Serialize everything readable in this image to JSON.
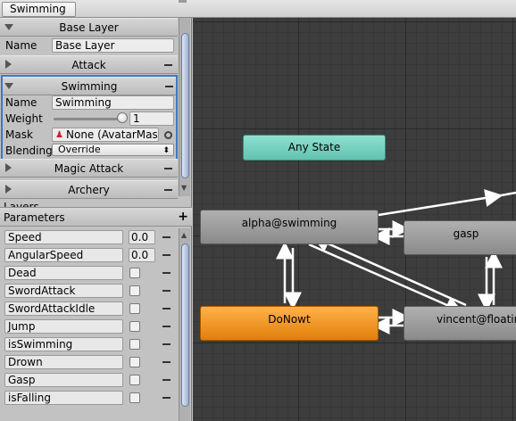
{
  "breadcrumb": {
    "label": "Swimming"
  },
  "layers": {
    "base": {
      "title": "Base Layer",
      "name_label": "Name",
      "name_value": "Base Layer"
    },
    "attack": {
      "title": "Attack"
    },
    "swimming": {
      "title": "Swimming",
      "name_label": "Name",
      "name_value": "Swimming",
      "weight_label": "Weight",
      "weight_value": "1",
      "weight_level": 1.0,
      "mask_label": "Mask",
      "mask_value": "None (AvatarMask)",
      "blending_label": "Blending",
      "blending_value": "Override"
    },
    "magic": {
      "title": "Magic Attack"
    },
    "archery": {
      "title": "Archery"
    },
    "footer_label": "Layers"
  },
  "parameters": {
    "title": "Parameters",
    "items": [
      {
        "name": "Speed",
        "type": "float",
        "value": "0.0"
      },
      {
        "name": "AngularSpeed",
        "type": "float",
        "value": "0.0"
      },
      {
        "name": "Dead",
        "type": "bool"
      },
      {
        "name": "SwordAttack",
        "type": "bool"
      },
      {
        "name": "SwordAttackIdle",
        "type": "bool"
      },
      {
        "name": "Jump",
        "type": "bool"
      },
      {
        "name": "isSwimming",
        "type": "bool"
      },
      {
        "name": "Drown",
        "type": "bool"
      },
      {
        "name": "Gasp",
        "type": "bool"
      },
      {
        "name": "isFalling",
        "type": "bool"
      }
    ]
  },
  "graph": {
    "nodes": {
      "any_state": "Any State",
      "alpha": "alpha@swimming",
      "gasp": "gasp",
      "donowt": "DoNowt",
      "vincent": "vincent@floating"
    }
  },
  "colors": {
    "selection": "#3f77c4",
    "any_state": "#72cfbd",
    "default_state": "#f0931f",
    "graph_bg": "#3d3d3d"
  }
}
